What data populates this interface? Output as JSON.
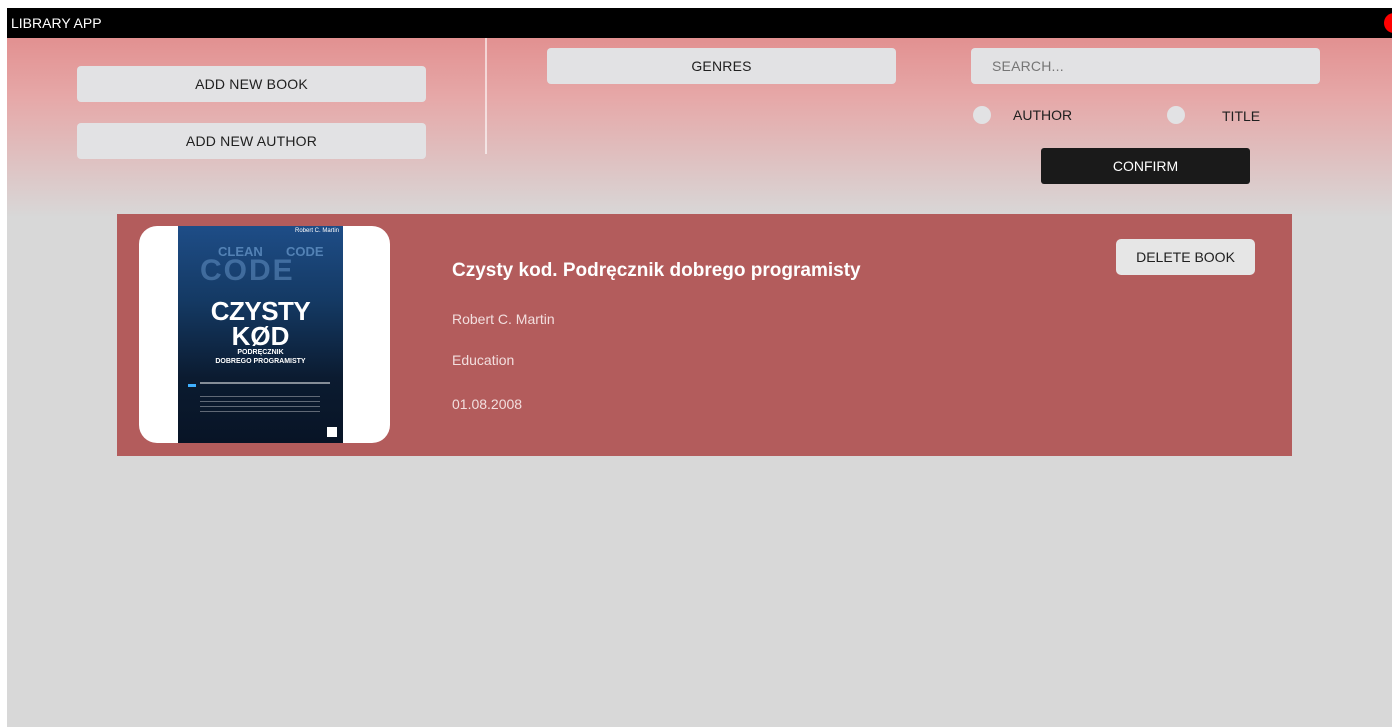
{
  "app": {
    "title": "LIBRARY APP"
  },
  "actions": {
    "add_book": "ADD NEW BOOK",
    "add_author": "ADD NEW AUTHOR",
    "genres": "GENRES",
    "confirm": "CONFIRM"
  },
  "search": {
    "placeholder": "SEARCH...",
    "options": [
      "AUTHOR",
      "TITLE"
    ]
  },
  "books": [
    {
      "title": "Czysty kod. Podręcznik dobrego programisty",
      "author": "Robert C. Martin",
      "genre": "Education",
      "date": "01.08.2008",
      "delete_label": "DELETE BOOK",
      "cover": {
        "author": "Robert C. Martin",
        "bg_words": [
          "CLEAN",
          "CODE",
          "CODE"
        ],
        "title_line1": "CZYSTY",
        "title_line2": "KØD",
        "subtitle_line1": "PODRĘCZNIK",
        "subtitle_line2": "DOBREGO PROGRAMISTY"
      }
    }
  ],
  "colors": {
    "titlebar": "#000000",
    "close_button": "#ff0000",
    "card": "#b35c5c",
    "confirm": "#1a1a1a",
    "gradient_top": "#e08585",
    "background": "#d8d8d8"
  }
}
